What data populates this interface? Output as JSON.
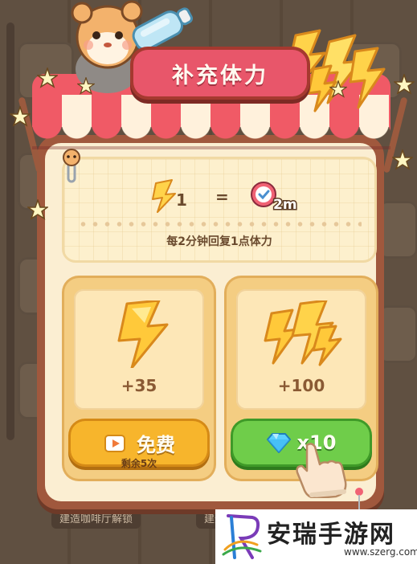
{
  "dialog": {
    "title": "补充体力",
    "info": {
      "energy_amount": "1",
      "equals": "=",
      "time_label": "2m",
      "description": "每2分钟回复1点体力"
    },
    "offers": [
      {
        "amount": "+35",
        "button_label": "免费",
        "button_sub": "剩余5次",
        "icon": "lightning-bolt-icon"
      },
      {
        "amount": "+100",
        "button_label": "x10",
        "icon": "triple-lightning-icon",
        "cost_icon": "diamond-icon"
      }
    ]
  },
  "background": {
    "labels": [
      "建造咖啡厅解锁",
      "建造"
    ]
  },
  "watermark": {
    "title": "安瑞手游网",
    "url": "www.szerg.com"
  },
  "colors": {
    "title_banner": "#e8566a",
    "panel_border": "#a0583d",
    "panel_fill": "#fbeed2",
    "free_button": "#f7b52c",
    "gem_button": "#6fcd4a"
  }
}
